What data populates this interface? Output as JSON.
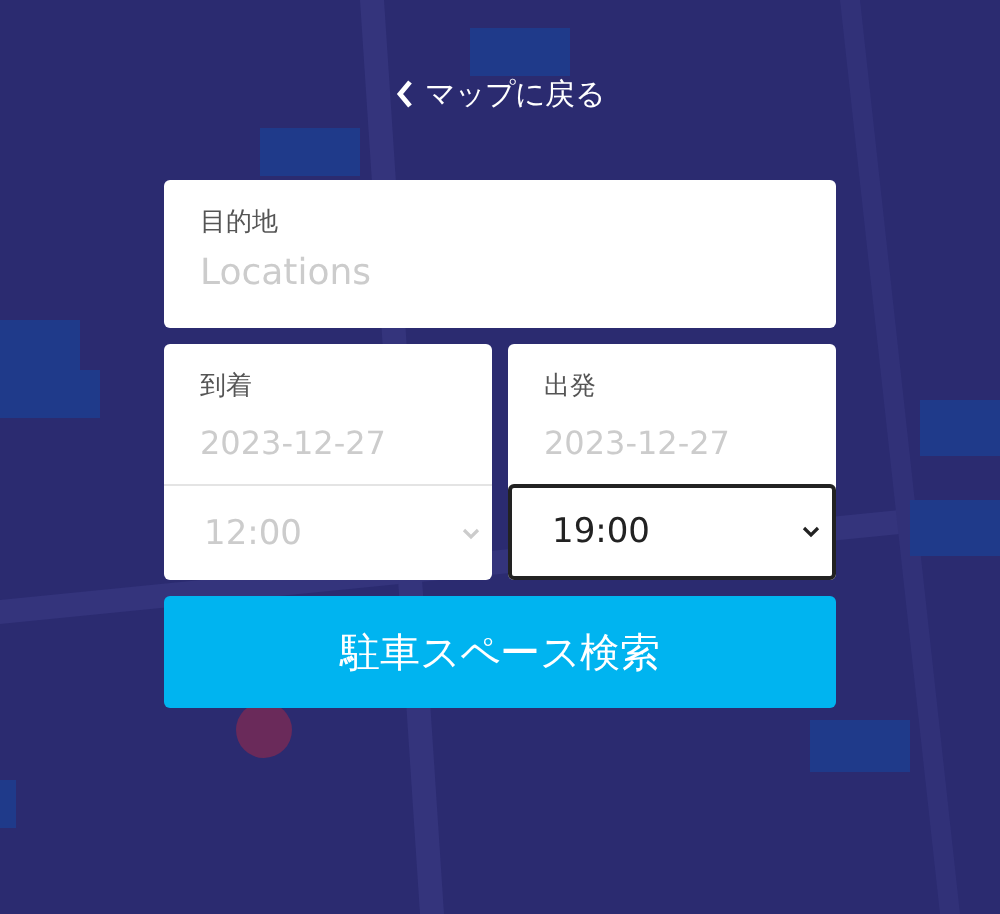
{
  "back_link": {
    "label": "マップに戻る"
  },
  "destination": {
    "label": "目的地",
    "placeholder": "Locations"
  },
  "schedule": [
    {
      "label": "到着",
      "date_placeholder": "2023-12-27",
      "time": "12:00",
      "focused": false
    },
    {
      "label": "出発",
      "date_placeholder": "2023-12-27",
      "time": "19:00",
      "focused": true
    }
  ],
  "search_button": {
    "label": "駐車スペース検索"
  }
}
